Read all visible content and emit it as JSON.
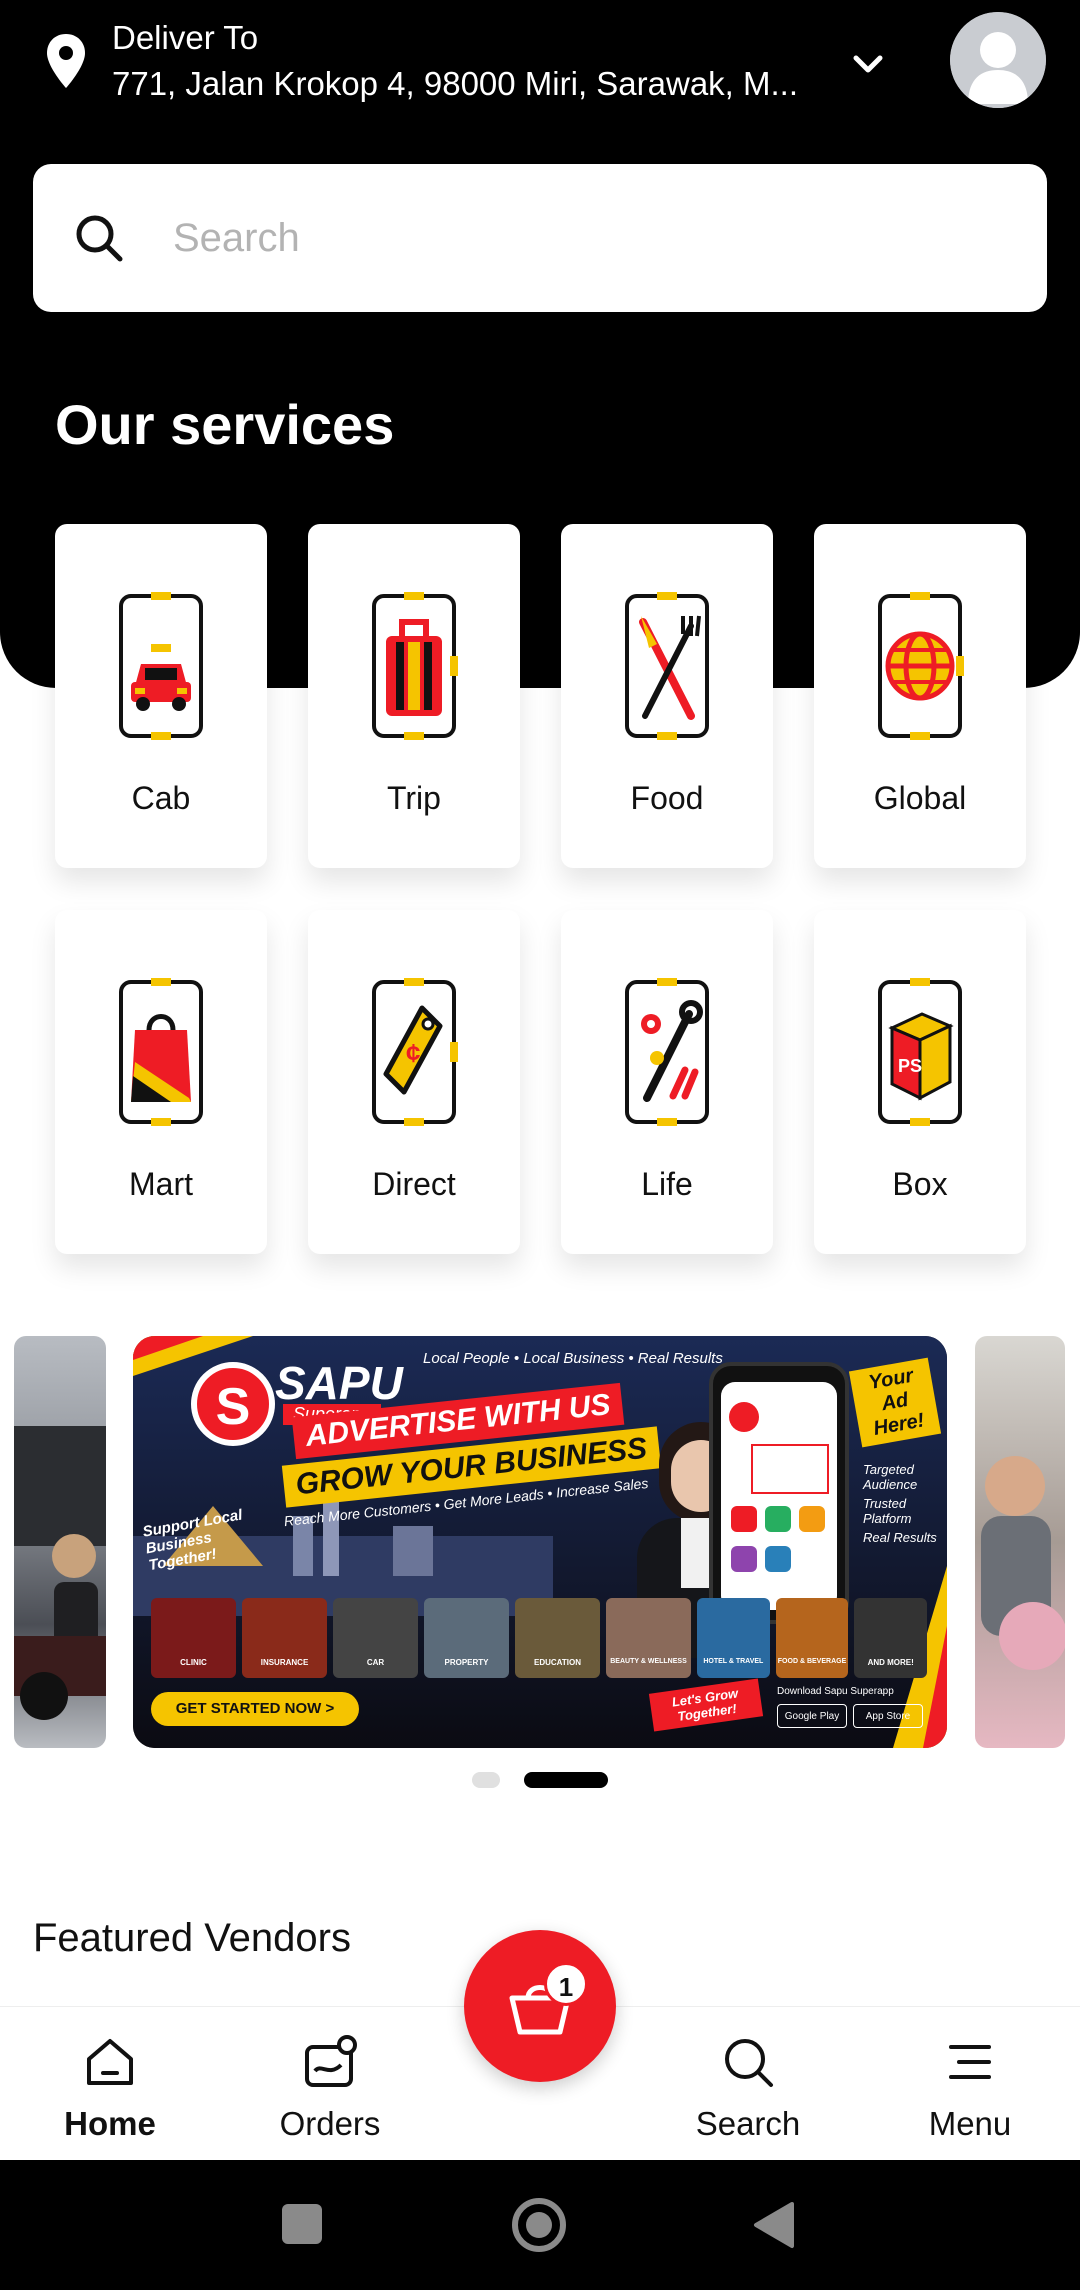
{
  "header": {
    "deliver_label": "Deliver To",
    "address": "771, Jalan Krokop 4, 98000 Miri, Sarawak, M..."
  },
  "search": {
    "placeholder": "Search"
  },
  "services": {
    "title": "Our services",
    "items": [
      {
        "label": "Cab",
        "icon": "taxi-icon"
      },
      {
        "label": "Trip",
        "icon": "luggage-icon"
      },
      {
        "label": "Food",
        "icon": "knife-fork-icon"
      },
      {
        "label": "Global",
        "icon": "globe-icon"
      },
      {
        "label": "Mart",
        "icon": "shopping-bag-icon"
      },
      {
        "label": "Direct",
        "icon": "price-tag-icon"
      },
      {
        "label": "Life",
        "icon": "tools-icon"
      },
      {
        "label": "Box",
        "icon": "parcel-box-icon"
      }
    ]
  },
  "banner": {
    "brand": "SAPU",
    "brand_sub": "Superapp",
    "tagline": "Local People • Local Business • Real Results",
    "headline1": "ADVERTISE WITH US",
    "headline2": "GROW YOUR BUSINESS",
    "subline": "Reach More Customers • Get More Leads • Increase Sales",
    "support": "Support Local Business Together!",
    "your_ad": "Your Ad Here!",
    "benefits": [
      "Targeted Audience",
      "Trusted Platform",
      "Real Results"
    ],
    "categories": [
      "CLINIC",
      "INSURANCE",
      "CAR",
      "PROPERTY",
      "EDUCATION",
      "BEAUTY & WELLNESS",
      "HOTEL & TRAVEL",
      "FOOD & BEVERAGE",
      "AND MORE!"
    ],
    "cta": "GET STARTED NOW >",
    "grow": "Let's Grow Together!",
    "download": "Download Sapu Superapp",
    "google_play": "Google Play",
    "app_store": "App Store",
    "page_index": 2,
    "page_count": 2
  },
  "featured": {
    "title": "Featured Vendors"
  },
  "bottom_nav": {
    "home": "Home",
    "orders": "Orders",
    "search": "Search",
    "menu": "Menu",
    "cart_count": "1"
  },
  "colors": {
    "accent_red": "#ee1c25",
    "accent_yellow": "#f5c400",
    "dark": "#000000"
  }
}
